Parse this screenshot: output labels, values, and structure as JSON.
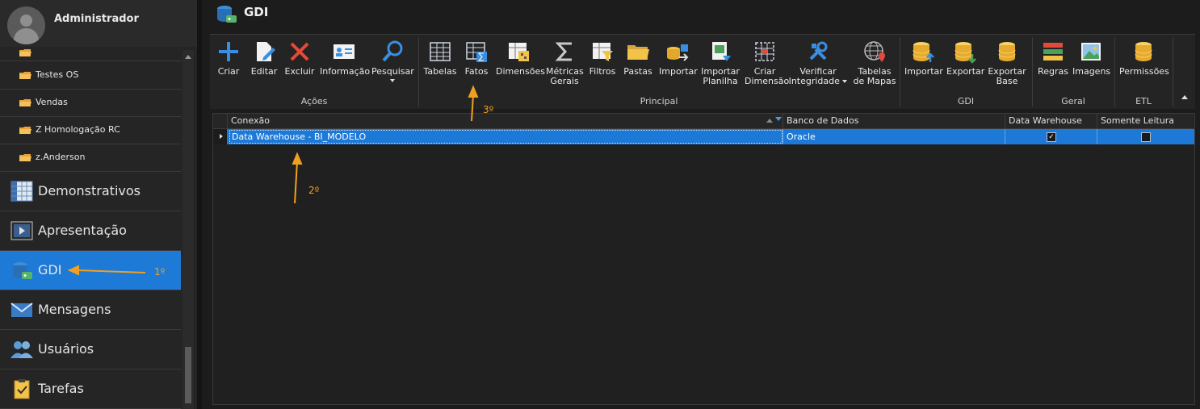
{
  "sidebar": {
    "user_name": "Administrador",
    "folders": [
      {
        "label": "Testes OS"
      },
      {
        "label": "Vendas"
      },
      {
        "label": "Z Homologação RC"
      },
      {
        "label": "z.Anderson"
      }
    ],
    "modules": [
      {
        "label": "Demonstrativos",
        "icon": "table-icon"
      },
      {
        "label": "Apresentação",
        "icon": "film-icon"
      },
      {
        "label": "GDI",
        "icon": "database-icon",
        "active": true
      },
      {
        "label": "Mensagens",
        "icon": "envelope-icon"
      },
      {
        "label": "Usuários",
        "icon": "users-icon"
      },
      {
        "label": "Tarefas",
        "icon": "clipboard-icon"
      }
    ]
  },
  "page": {
    "title": "GDI"
  },
  "ribbon": {
    "groups": [
      {
        "label": "Ações"
      },
      {
        "label": "Principal"
      },
      {
        "label": "GDI"
      },
      {
        "label": "Geral"
      },
      {
        "label": "ETL"
      }
    ],
    "buttons": {
      "criar": "Criar",
      "editar": "Editar",
      "excluir": "Excluir",
      "informacao": "Informação",
      "pesquisar": "Pesquisar",
      "tabelas": "Tabelas",
      "fatos": "Fatos",
      "dimensoes": "Dimensões",
      "metricas_1": "Métricas",
      "metricas_2": "Gerais",
      "filtros": "Filtros",
      "pastas": "Pastas",
      "importar": "Importar",
      "importar_planilha_1": "Importar",
      "importar_planilha_2": "Planilha",
      "criar_dimensao_1": "Criar",
      "criar_dimensao_2": "Dimensão",
      "verificar_1": "Verificar",
      "verificar_2": "Integridade",
      "tabelas_mapas_1": "Tabelas",
      "tabelas_mapas_2": "de Mapas",
      "gdi_importar": "Importar",
      "gdi_exportar": "Exportar",
      "gdi_exportar_base_1": "Exportar",
      "gdi_exportar_base_2": "Base",
      "regras": "Regras",
      "imagens": "Imagens",
      "permissoes": "Permissões"
    }
  },
  "grid": {
    "columns": [
      "Conexão",
      "Banco de Dados",
      "Data Warehouse",
      "Somente Leitura"
    ],
    "rows": [
      {
        "conexao": "Data Warehouse - BI_MODELO",
        "banco": "Oracle",
        "data_warehouse": true,
        "somente_leitura": false
      }
    ]
  },
  "annotations": {
    "first": "1º",
    "second": "2º",
    "third": "3º"
  },
  "colors": {
    "accent": "#1d7ad6",
    "annotation": "#f0a020"
  }
}
